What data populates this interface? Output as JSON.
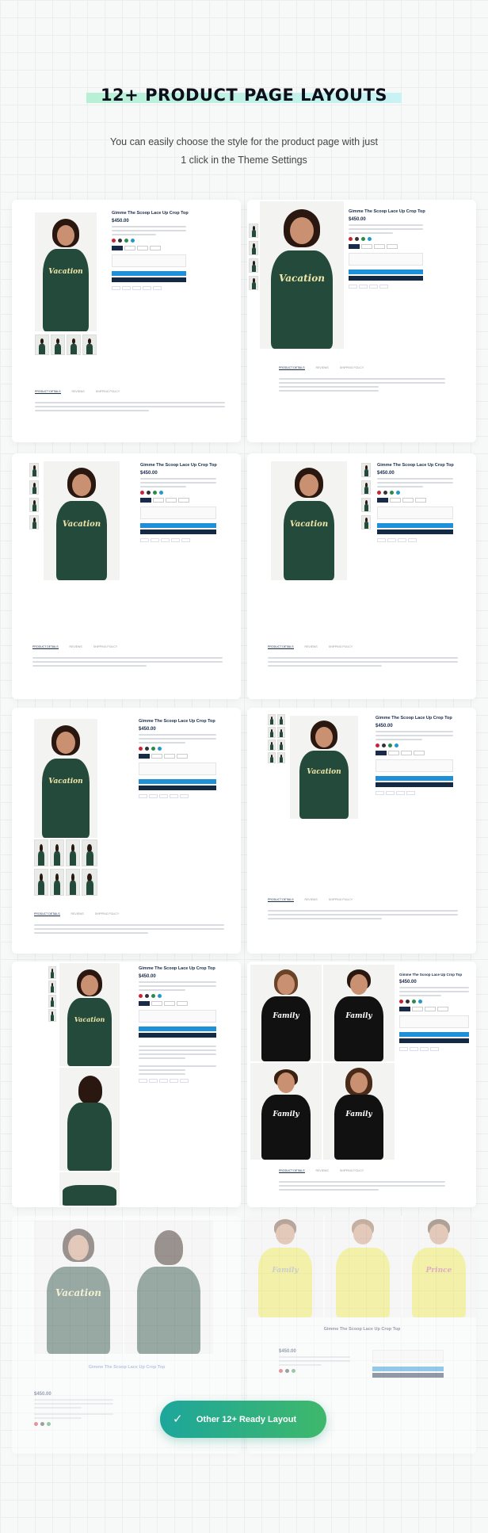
{
  "header": {
    "title": "12+ PRODUCT PAGE LAYOUTS",
    "subtitle_line1": "You can easily choose the style for the product page with just",
    "subtitle_line2": "1 click in the Theme Settings"
  },
  "product": {
    "name": "Gimme The Scoop Lace Up Crop Top",
    "price": "$450.00",
    "tab_labels": [
      "PRODUCT DETAILS",
      "REVIEWS",
      "SHIPPING POLICY"
    ]
  },
  "print_text": {
    "vacation": "Vacation",
    "family": "Family",
    "prince": "Prince"
  },
  "cta": {
    "label": "Other 12+ Ready Layout",
    "icon": "check-icon"
  },
  "colors": {
    "navy": "#1a2b4a",
    "blue": "#1e90d8",
    "green_shirt": "#244a3c",
    "cta_start": "#1da69b",
    "cta_end": "#3fb86b"
  }
}
